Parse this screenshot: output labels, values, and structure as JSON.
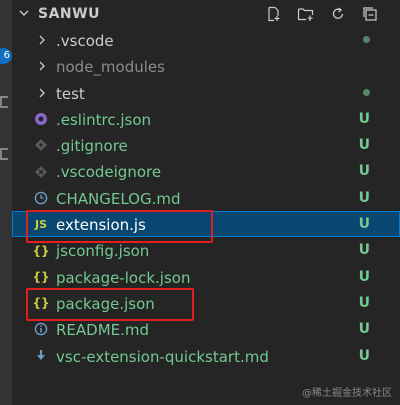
{
  "explorer": {
    "title": "SANWU",
    "actions": [
      "new-file-icon",
      "new-folder-icon",
      "refresh-icon",
      "collapse-all-icon"
    ]
  },
  "activity": {
    "badge": "6"
  },
  "tree": [
    {
      "name": ".vscode",
      "type": "folder",
      "status": "dot"
    },
    {
      "name": "node_modules",
      "type": "folder",
      "status": ""
    },
    {
      "name": "test",
      "type": "folder",
      "status": "dot"
    },
    {
      "name": ".eslintrc.json",
      "type": "eslint",
      "status": "U"
    },
    {
      "name": ".gitignore",
      "type": "git",
      "status": "U"
    },
    {
      "name": ".vscodeignore",
      "type": "vscodeignore",
      "status": "U"
    },
    {
      "name": "CHANGELOG.md",
      "type": "changelog",
      "status": "U"
    },
    {
      "name": "extension.js",
      "type": "js",
      "status": "U"
    },
    {
      "name": "jsconfig.json",
      "type": "json",
      "status": "U"
    },
    {
      "name": "package-lock.json",
      "type": "json",
      "status": "U"
    },
    {
      "name": "package.json",
      "type": "json",
      "status": "U"
    },
    {
      "name": "README.md",
      "type": "info",
      "status": "U"
    },
    {
      "name": "vsc-extension-quickstart.md",
      "type": "download",
      "status": "U"
    }
  ],
  "selected_index": 7,
  "colors": {
    "background": "#252526",
    "selection": "#094771",
    "untracked": "#73c991",
    "highlight_box": "#e02020"
  },
  "watermark": "@稀土掘金技术社区"
}
